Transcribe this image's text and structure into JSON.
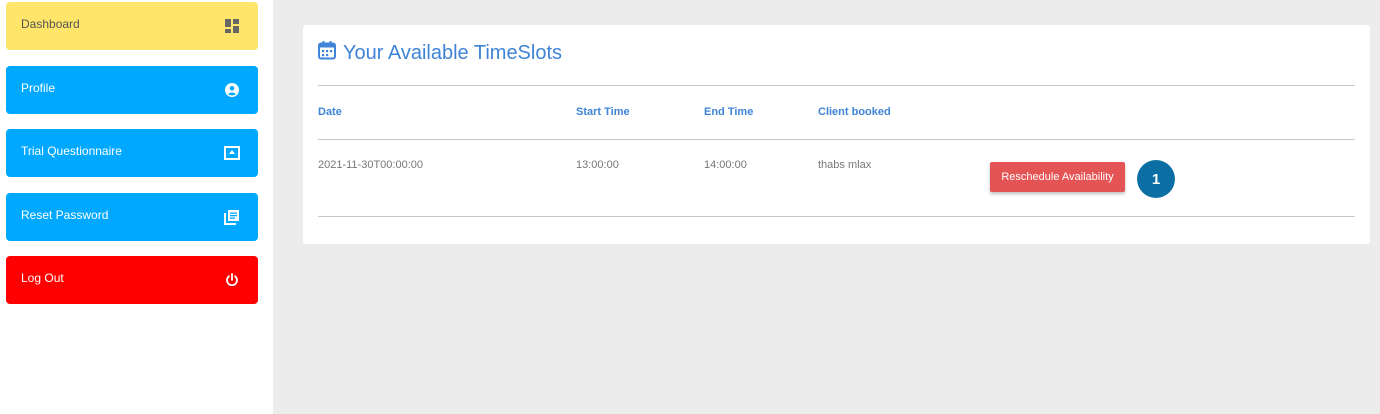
{
  "sidebar": {
    "items": [
      {
        "label": "Dashboard",
        "icon": "dashboard-icon"
      },
      {
        "label": "Profile",
        "icon": "user-circle-icon"
      },
      {
        "label": "Trial Questionnaire",
        "icon": "upload-box-icon"
      },
      {
        "label": "Reset Password",
        "icon": "library-books-icon"
      },
      {
        "label": "Log Out",
        "icon": "power-icon"
      }
    ]
  },
  "main": {
    "title": "Your Available TimeSlots",
    "title_icon": "calendar-icon",
    "table": {
      "headers": [
        "Date",
        "Start Time",
        "End Time",
        "Client booked"
      ],
      "rows": [
        {
          "date": "2021-11-30T00:00:00",
          "start": "13:00:00",
          "end": "14:00:00",
          "client": "thabs mlax",
          "action": "Reschedule Availability"
        }
      ]
    },
    "badge": "1"
  },
  "colors": {
    "dashboard": "#ffe66b",
    "nav_blue": "#00a9ff",
    "logout_red": "#ff0000",
    "accent_blue": "#3f84d6",
    "button_red": "#e55454",
    "badge_blue": "#0b6fa3"
  }
}
